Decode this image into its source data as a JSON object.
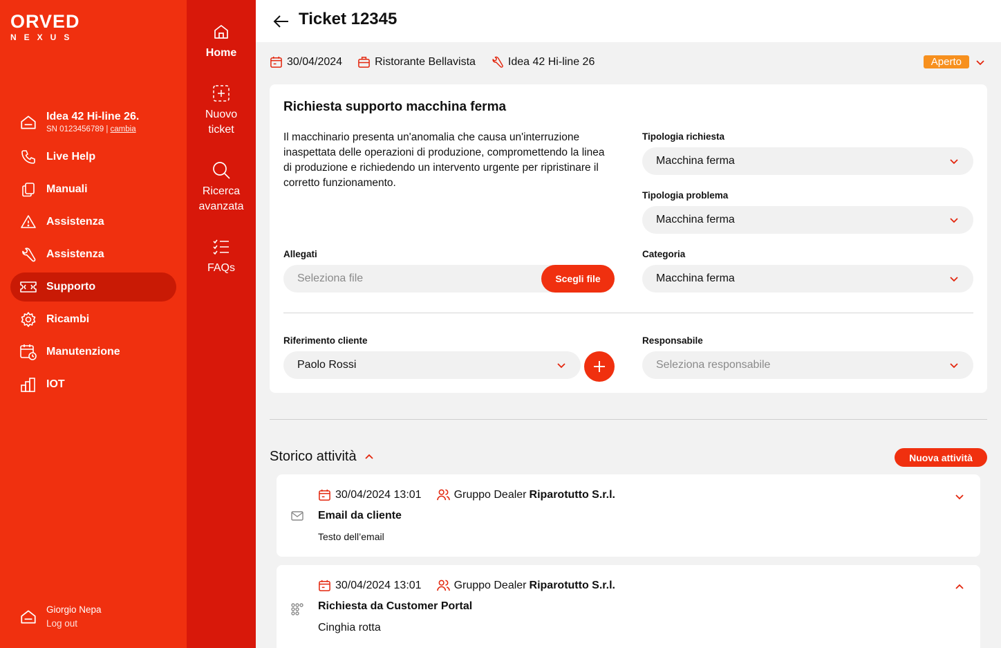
{
  "brand": {
    "line1": "ORVED",
    "line2": "NEXUS"
  },
  "machine": {
    "name": "Idea 42 Hi-line 26.",
    "sn": "SN 0123456789",
    "change_link": "cambia"
  },
  "sidebar": {
    "items": [
      {
        "label": "Live Help",
        "icon": "phone-icon"
      },
      {
        "label": "Manuali",
        "icon": "documents-icon"
      },
      {
        "label": "Assistenza",
        "icon": "warning-icon"
      },
      {
        "label": "Assistenza",
        "icon": "wrench-icon"
      },
      {
        "label": "Supporto",
        "icon": "ticket-icon",
        "active": true
      },
      {
        "label": "Ricambi",
        "icon": "gear-icon"
      },
      {
        "label": "Manutenzione",
        "icon": "calendar-clock-icon"
      },
      {
        "label": "IOT",
        "icon": "bar-chart-icon"
      }
    ]
  },
  "user": {
    "name": "Giorgio Nepa",
    "logout": "Log out"
  },
  "rail": {
    "home": "Home",
    "new_ticket_1": "Nuovo",
    "new_ticket_2": "ticket",
    "search_1": "Ricerca",
    "search_2": "avanzata",
    "faqs": "FAQs"
  },
  "header": {
    "title": "Ticket 12345"
  },
  "meta": {
    "date": "30/04/2024",
    "client": "Ristorante Bellavista",
    "machine": "Idea 42 Hi-line 26"
  },
  "status": {
    "label": "Aperto",
    "color": "#f7901e"
  },
  "request": {
    "title": "Richiesta supporto macchina ferma",
    "description": "Il macchinario presenta un'anomalia che causa un'interruzione inaspettata delle operazioni di produzione, compromettendo la linea di produzione e richiedendo un intervento urgente per ripristinare il corretto funzionamento.",
    "tipologia_richiesta_label": "Tipologia richiesta",
    "tipologia_richiesta_value": "Macchina ferma",
    "tipologia_problema_label": "Tipologia problema",
    "tipologia_problema_value": "Macchina ferma",
    "categoria_label": "Categoria",
    "categoria_value": "Macchina ferma",
    "allegati_label": "Allegati",
    "allegati_placeholder": "Seleziona file",
    "allegati_button": "Scegli file",
    "riferimento_label": "Riferimento cliente",
    "riferimento_value": "Paolo Rossi",
    "responsabile_label": "Responsabile",
    "responsabile_placeholder": "Seleziona responsabile"
  },
  "history": {
    "title": "Storico attività",
    "new_button": "Nuova attività",
    "activities": [
      {
        "datetime": "30/04/2024 13:01",
        "group_prefix": "Gruppo Dealer",
        "group_name": "Riparotutto S.r.l.",
        "title": "Email da cliente",
        "body": "Testo dell’email",
        "icon": "mail-icon"
      },
      {
        "datetime": "30/04/2024 13:01",
        "group_prefix": "Gruppo Dealer",
        "group_name": "Riparotutto S.r.l.",
        "title": "Richiesta da Customer Portal",
        "body": "Cinghia rotta",
        "icon": "portal-icon"
      }
    ]
  },
  "colors": {
    "accent": "#f0300f",
    "rail": "#d8180a",
    "active_nav": "#c91a05"
  }
}
